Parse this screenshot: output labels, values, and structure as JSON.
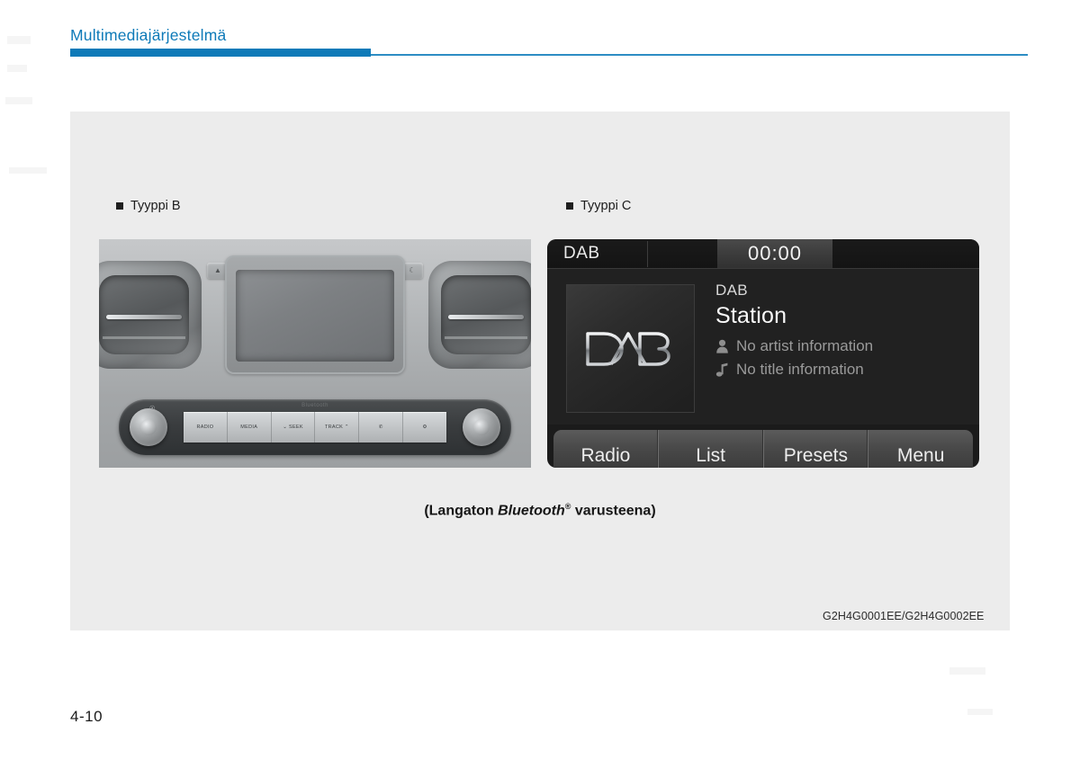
{
  "header": {
    "title": "Multimediajärjestelmä",
    "accent_color": "#0e7ab8",
    "rule_color": "#2d8dc4"
  },
  "figures": [
    {
      "label": "Tyyppi B",
      "kind": "photo-head-unit"
    },
    {
      "label": "Tyyppi C",
      "kind": "screen-dab"
    }
  ],
  "type_b": {
    "label": "Tyyppi B",
    "cd_slot": {
      "eject_icon": "eject-icon",
      "display_icon": "moon-icon"
    },
    "bluetooth_mark": "Bluetooth",
    "buttons": [
      {
        "label": "RADIO",
        "name": "radio-button"
      },
      {
        "label": "MEDIA",
        "name": "media-button"
      },
      {
        "label": "⌄ SEEK",
        "name": "seek-button"
      },
      {
        "label": "TRACK ⌃",
        "name": "track-button"
      },
      {
        "label": "✆",
        "name": "phone-button"
      },
      {
        "label": "⚙",
        "name": "setup-button"
      }
    ],
    "left_knob": "power-volume-knob",
    "right_knob": "tune-knob"
  },
  "type_c": {
    "label": "Tyyppi C",
    "status_bar": {
      "source": "DAB",
      "clock": "00:00"
    },
    "now_playing": {
      "artwork_logo": "DAB",
      "kind": "DAB",
      "station": "Station",
      "artist_icon": "person-icon",
      "artist": "No artist information",
      "title_icon": "music-note-icon",
      "title": "No title information"
    },
    "tabs": [
      {
        "label": "Radio",
        "name": "tab-radio"
      },
      {
        "label": "List",
        "name": "tab-list"
      },
      {
        "label": "Presets",
        "name": "tab-presets"
      },
      {
        "label": "Menu",
        "name": "tab-menu"
      }
    ]
  },
  "caption": {
    "prefix": "(Langaton ",
    "emphasis": "Bluetooth",
    "registered": "®",
    "suffix": " varusteena)"
  },
  "figure_code": "G2H4G0001EE/G2H4G0002EE",
  "page_number": "4-10"
}
